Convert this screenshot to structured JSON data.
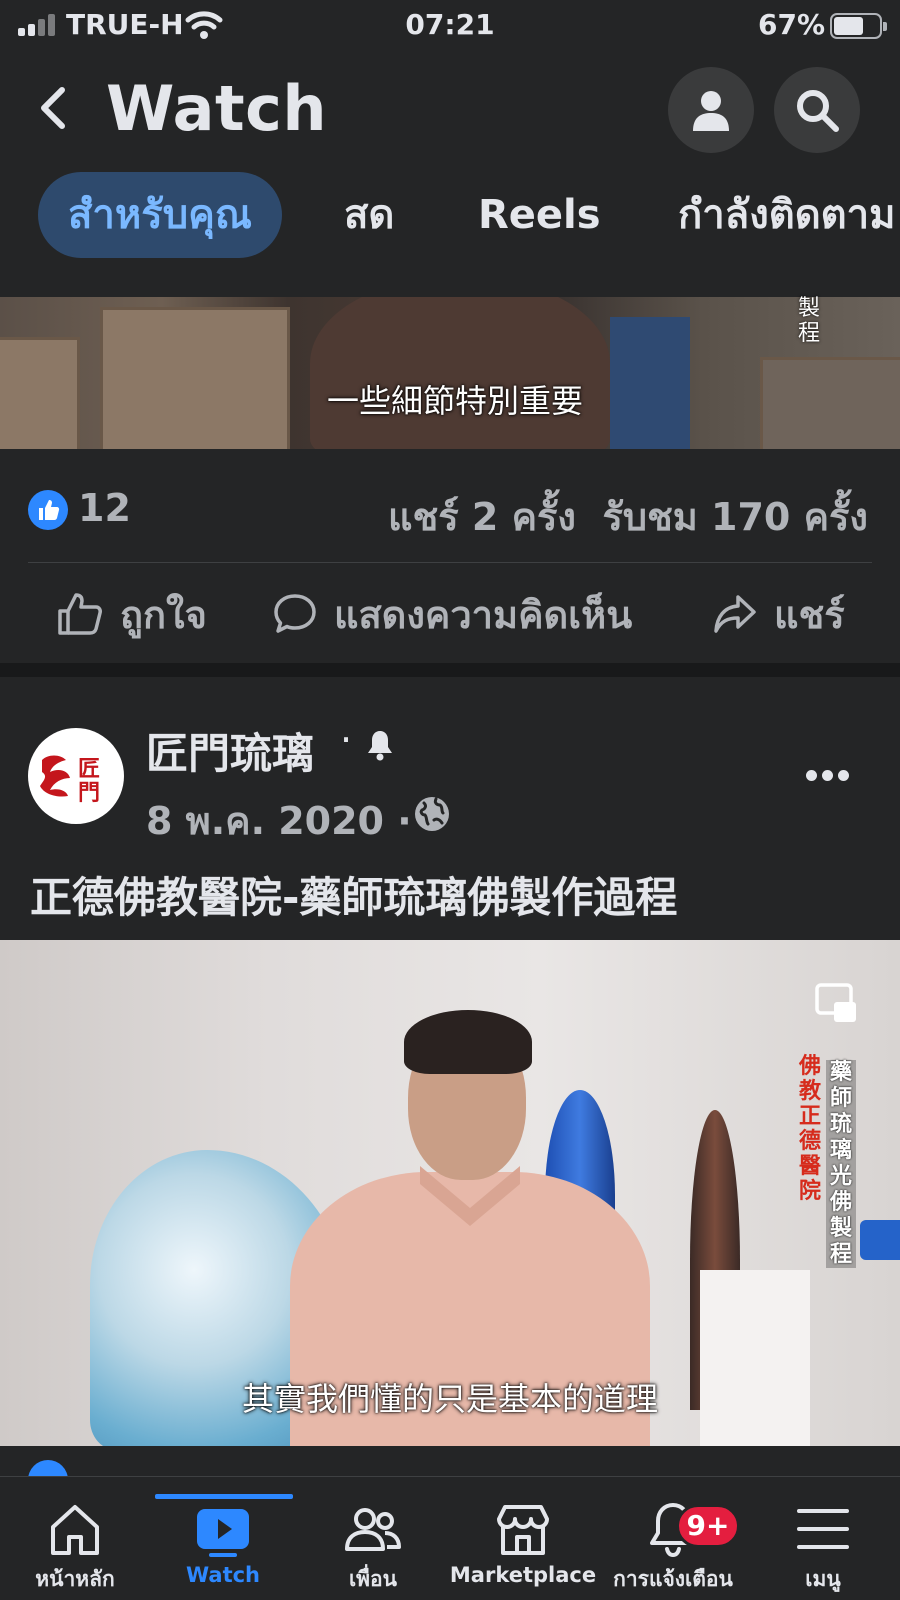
{
  "status_bar": {
    "carrier": "TRUE-H",
    "time": "07:21",
    "battery_percent": "67%",
    "battery_level": 0.67,
    "signal_bars_filled": 2,
    "signal_bars_total": 4
  },
  "header": {
    "title": "Watch",
    "back_icon": "chevron-left-icon",
    "profile_icon": "person-icon",
    "search_icon": "search-icon"
  },
  "tabs": [
    {
      "label": "สำหรับคุณ",
      "active": true
    },
    {
      "label": "สด",
      "active": false
    },
    {
      "label": "Reels",
      "active": false
    },
    {
      "label": "กำลังติดตาม",
      "active": false
    }
  ],
  "post1": {
    "video_subtitle": "一些細節特別重要",
    "video_side_text": "製程",
    "like_count": "12",
    "shares": "แชร์ 2 ครั้ง",
    "views": "รับชม 170 ครั้ง",
    "actions": {
      "like": "ถูกใจ",
      "comment": "แสดงความคิดเห็น",
      "share": "แชร์"
    }
  },
  "post2": {
    "page_name": "匠門琉璃",
    "separator": "·",
    "date": "8 พ.ค. 2020 ·",
    "caption": "正德佛教醫院-藥師琉璃佛製作過程",
    "avatar_text": "匠門",
    "video_subtitle": "其實我們懂的只是基本的道理",
    "video_side_red": "佛教正德醫院",
    "video_side_white": "藥師琉璃光佛製程"
  },
  "bottom_nav": [
    {
      "label": "หน้าหลัก",
      "icon": "home-icon",
      "active": false
    },
    {
      "label": "Watch",
      "icon": "watch-play-icon",
      "active": true
    },
    {
      "label": "เพื่อน",
      "icon": "friends-icon",
      "active": false
    },
    {
      "label": "Marketplace",
      "icon": "marketplace-icon",
      "active": false
    },
    {
      "label": "การแจ้งเตือน",
      "icon": "bell-icon",
      "active": false
    },
    {
      "label": "เมนู",
      "icon": "menu-icon",
      "active": false
    }
  ],
  "notification_badge": "9+",
  "colors": {
    "background": "#242526",
    "accent": "#2d88ff",
    "active_tab_bg": "#2e4a6d",
    "badge_red": "#e41e3f"
  }
}
